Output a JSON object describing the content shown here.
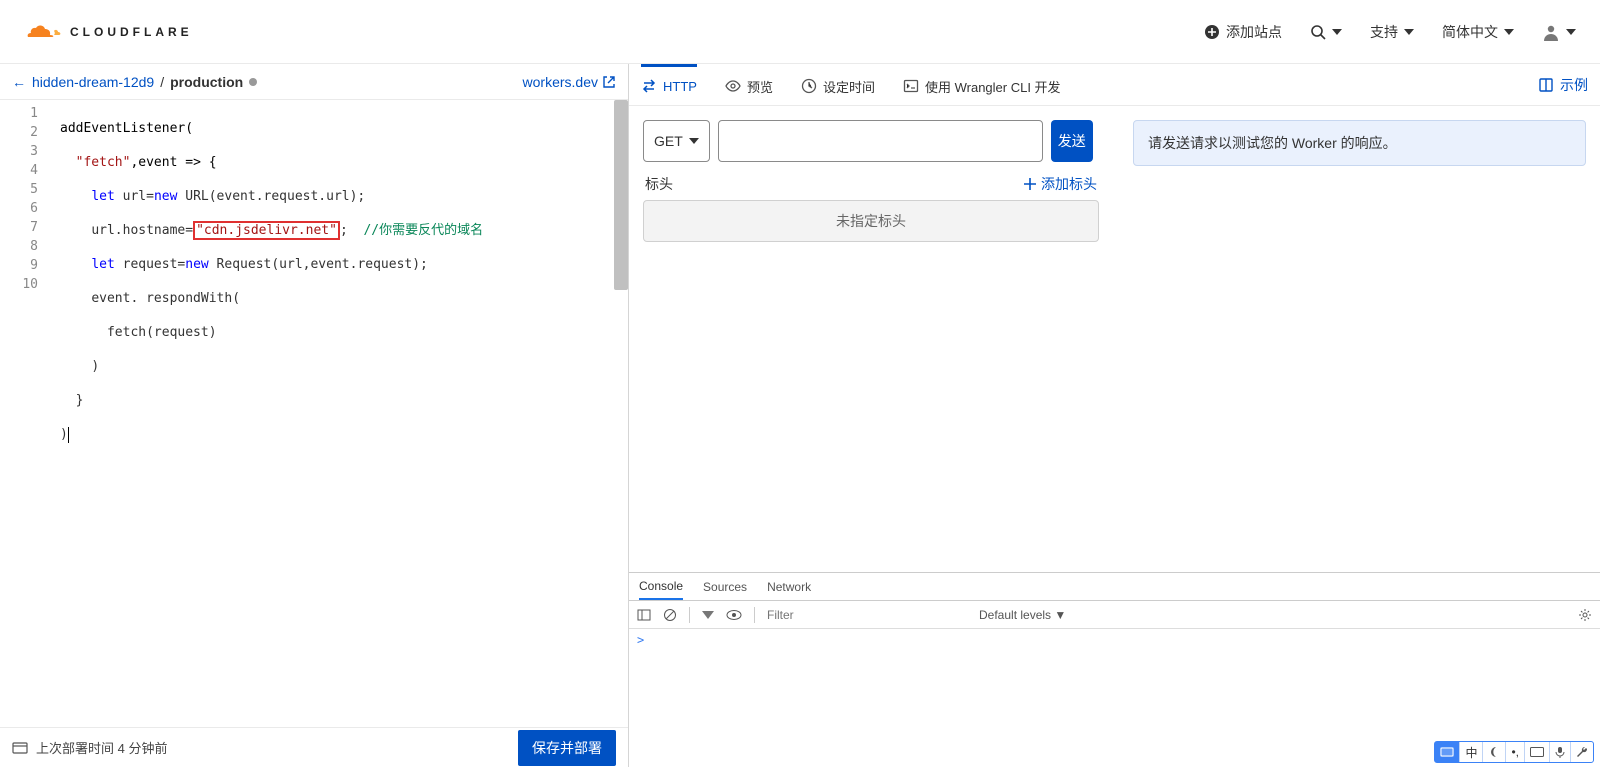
{
  "brand": "CLOUDFLARE",
  "header": {
    "add_site": "添加站点",
    "support": "支持",
    "language": "简体中文"
  },
  "breadcrumb": {
    "back": "←",
    "name": "hidden-dream-12d9",
    "sep": "/",
    "env": "production",
    "workers_link": "workers.dev"
  },
  "code": {
    "lines": [
      "1",
      "2",
      "3",
      "4",
      "5",
      "6",
      "7",
      "8",
      "9",
      "10"
    ],
    "l1_a": "addEventListener",
    "l1_b": "(",
    "l2_a": "\"fetch\"",
    "l2_b": ",event => {",
    "l3_a": "let",
    "l3_b": " url=",
    "l3_c": "new",
    "l3_d": " URL(event.request.url);",
    "l4_a": "url.hostname=",
    "l4_b": "\"cdn.jsdelivr.net\"",
    "l4_c": ";",
    "l4_d": "//你需要反代的域名",
    "l5_a": "let",
    "l5_b": " request=",
    "l5_c": "new",
    "l5_d": " Request(url,event.request);",
    "l6": "event. respondWith(",
    "l7": "fetch(request)",
    "l8": ")",
    "l9": "}",
    "l10": ")"
  },
  "footer": {
    "last_deploy": "上次部署时间 4 分钟前",
    "deploy": "保存并部署"
  },
  "tabs": {
    "http": "HTTP",
    "preview": "预览",
    "schedule": "设定时间",
    "cli": "使用 Wrangler CLI 开发",
    "example": "示例"
  },
  "request": {
    "method": "GET",
    "send": "发送",
    "response_hint": "请发送请求以测试您的 Worker 的响应。",
    "headers_label": "标头",
    "add_header": "添加标头",
    "no_headers": "未指定标头"
  },
  "devtools": {
    "console": "Console",
    "sources": "Sources",
    "network": "Network",
    "filter_placeholder": "Filter",
    "levels": "Default levels",
    "prompt": ">"
  },
  "ime": {
    "zhong": "中"
  }
}
